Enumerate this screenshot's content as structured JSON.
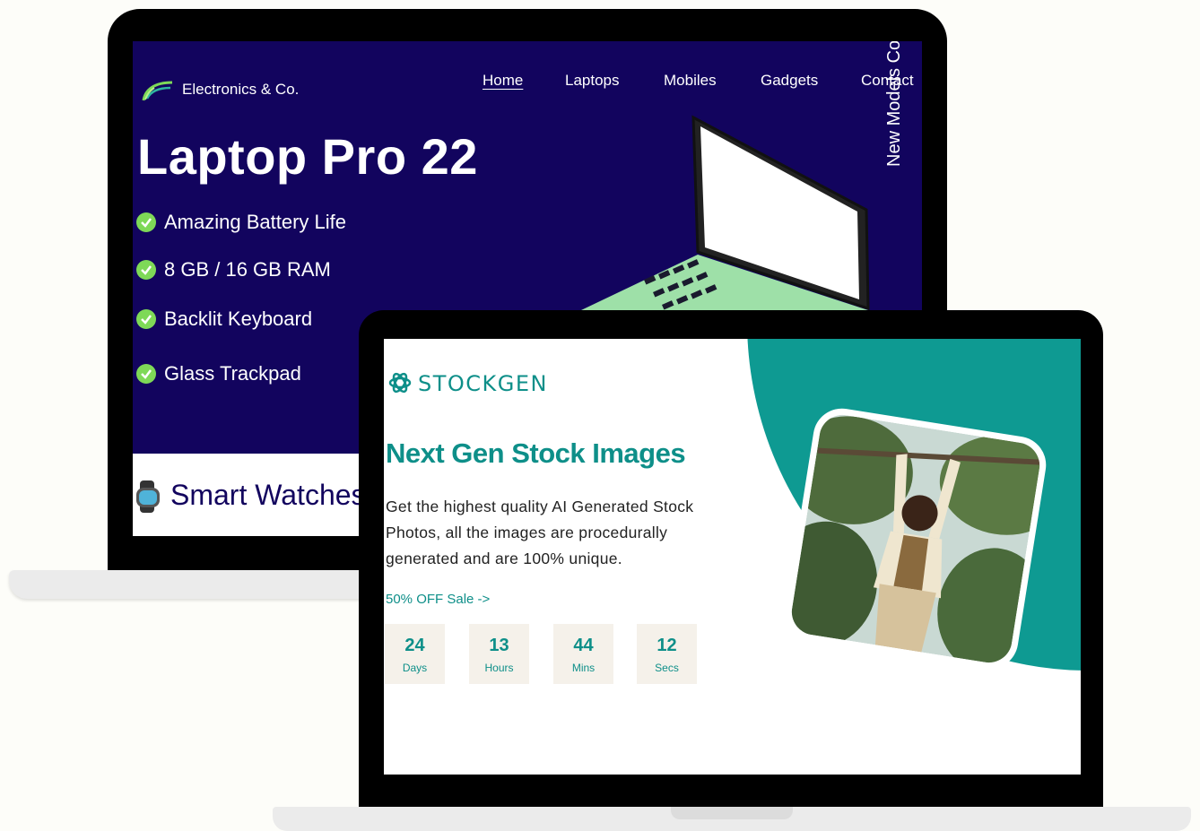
{
  "back_laptop": {
    "brand": "Electronics & Co.",
    "nav": [
      "Home",
      "Laptops",
      "Mobiles",
      "Gadgets",
      "Contact"
    ],
    "title": "Laptop Pro 22",
    "features": [
      "Amazing Battery Life",
      "8 GB / 16 GB RAM",
      "Backlit Keyboard",
      "Glass Trackpad"
    ],
    "vertical_text": "New Models Coming Soon",
    "second_section": "Smart Watches",
    "colors": {
      "background": "#12045e",
      "check": "#7ed957"
    }
  },
  "front_laptop": {
    "brand": "STOCKGEN",
    "headline": "Next Gen Stock Images",
    "description": "Get the highest quality AI Generated Stock Photos, all the images are procedurally generated and are 100% unique.",
    "sale_link": "50% OFF Sale ->",
    "countdown": [
      {
        "value": "24",
        "unit": "Days"
      },
      {
        "value": "13",
        "unit": "Hours"
      },
      {
        "value": "44",
        "unit": "Mins"
      },
      {
        "value": "12",
        "unit": "Secs"
      }
    ],
    "colors": {
      "accent": "#0e9a92"
    }
  }
}
